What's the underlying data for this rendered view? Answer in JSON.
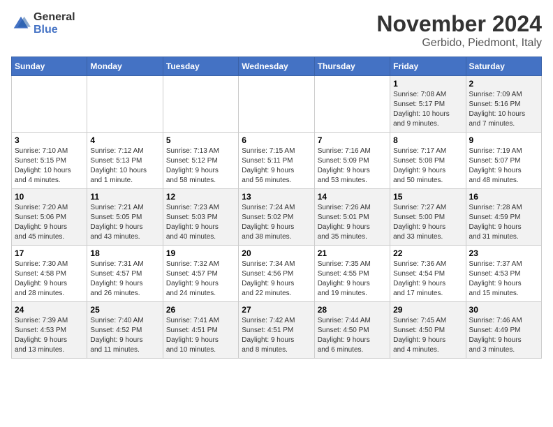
{
  "logo": {
    "general": "General",
    "blue": "Blue"
  },
  "title": "November 2024",
  "location": "Gerbido, Piedmont, Italy",
  "days_header": [
    "Sunday",
    "Monday",
    "Tuesday",
    "Wednesday",
    "Thursday",
    "Friday",
    "Saturday"
  ],
  "weeks": [
    [
      {
        "day": "",
        "info": ""
      },
      {
        "day": "",
        "info": ""
      },
      {
        "day": "",
        "info": ""
      },
      {
        "day": "",
        "info": ""
      },
      {
        "day": "",
        "info": ""
      },
      {
        "day": "1",
        "info": "Sunrise: 7:08 AM\nSunset: 5:17 PM\nDaylight: 10 hours\nand 9 minutes."
      },
      {
        "day": "2",
        "info": "Sunrise: 7:09 AM\nSunset: 5:16 PM\nDaylight: 10 hours\nand 7 minutes."
      }
    ],
    [
      {
        "day": "3",
        "info": "Sunrise: 7:10 AM\nSunset: 5:15 PM\nDaylight: 10 hours\nand 4 minutes."
      },
      {
        "day": "4",
        "info": "Sunrise: 7:12 AM\nSunset: 5:13 PM\nDaylight: 10 hours\nand 1 minute."
      },
      {
        "day": "5",
        "info": "Sunrise: 7:13 AM\nSunset: 5:12 PM\nDaylight: 9 hours\nand 58 minutes."
      },
      {
        "day": "6",
        "info": "Sunrise: 7:15 AM\nSunset: 5:11 PM\nDaylight: 9 hours\nand 56 minutes."
      },
      {
        "day": "7",
        "info": "Sunrise: 7:16 AM\nSunset: 5:09 PM\nDaylight: 9 hours\nand 53 minutes."
      },
      {
        "day": "8",
        "info": "Sunrise: 7:17 AM\nSunset: 5:08 PM\nDaylight: 9 hours\nand 50 minutes."
      },
      {
        "day": "9",
        "info": "Sunrise: 7:19 AM\nSunset: 5:07 PM\nDaylight: 9 hours\nand 48 minutes."
      }
    ],
    [
      {
        "day": "10",
        "info": "Sunrise: 7:20 AM\nSunset: 5:06 PM\nDaylight: 9 hours\nand 45 minutes."
      },
      {
        "day": "11",
        "info": "Sunrise: 7:21 AM\nSunset: 5:05 PM\nDaylight: 9 hours\nand 43 minutes."
      },
      {
        "day": "12",
        "info": "Sunrise: 7:23 AM\nSunset: 5:03 PM\nDaylight: 9 hours\nand 40 minutes."
      },
      {
        "day": "13",
        "info": "Sunrise: 7:24 AM\nSunset: 5:02 PM\nDaylight: 9 hours\nand 38 minutes."
      },
      {
        "day": "14",
        "info": "Sunrise: 7:26 AM\nSunset: 5:01 PM\nDaylight: 9 hours\nand 35 minutes."
      },
      {
        "day": "15",
        "info": "Sunrise: 7:27 AM\nSunset: 5:00 PM\nDaylight: 9 hours\nand 33 minutes."
      },
      {
        "day": "16",
        "info": "Sunrise: 7:28 AM\nSunset: 4:59 PM\nDaylight: 9 hours\nand 31 minutes."
      }
    ],
    [
      {
        "day": "17",
        "info": "Sunrise: 7:30 AM\nSunset: 4:58 PM\nDaylight: 9 hours\nand 28 minutes."
      },
      {
        "day": "18",
        "info": "Sunrise: 7:31 AM\nSunset: 4:57 PM\nDaylight: 9 hours\nand 26 minutes."
      },
      {
        "day": "19",
        "info": "Sunrise: 7:32 AM\nSunset: 4:57 PM\nDaylight: 9 hours\nand 24 minutes."
      },
      {
        "day": "20",
        "info": "Sunrise: 7:34 AM\nSunset: 4:56 PM\nDaylight: 9 hours\nand 22 minutes."
      },
      {
        "day": "21",
        "info": "Sunrise: 7:35 AM\nSunset: 4:55 PM\nDaylight: 9 hours\nand 19 minutes."
      },
      {
        "day": "22",
        "info": "Sunrise: 7:36 AM\nSunset: 4:54 PM\nDaylight: 9 hours\nand 17 minutes."
      },
      {
        "day": "23",
        "info": "Sunrise: 7:37 AM\nSunset: 4:53 PM\nDaylight: 9 hours\nand 15 minutes."
      }
    ],
    [
      {
        "day": "24",
        "info": "Sunrise: 7:39 AM\nSunset: 4:53 PM\nDaylight: 9 hours\nand 13 minutes."
      },
      {
        "day": "25",
        "info": "Sunrise: 7:40 AM\nSunset: 4:52 PM\nDaylight: 9 hours\nand 11 minutes."
      },
      {
        "day": "26",
        "info": "Sunrise: 7:41 AM\nSunset: 4:51 PM\nDaylight: 9 hours\nand 10 minutes."
      },
      {
        "day": "27",
        "info": "Sunrise: 7:42 AM\nSunset: 4:51 PM\nDaylight: 9 hours\nand 8 minutes."
      },
      {
        "day": "28",
        "info": "Sunrise: 7:44 AM\nSunset: 4:50 PM\nDaylight: 9 hours\nand 6 minutes."
      },
      {
        "day": "29",
        "info": "Sunrise: 7:45 AM\nSunset: 4:50 PM\nDaylight: 9 hours\nand 4 minutes."
      },
      {
        "day": "30",
        "info": "Sunrise: 7:46 AM\nSunset: 4:49 PM\nDaylight: 9 hours\nand 3 minutes."
      }
    ]
  ]
}
